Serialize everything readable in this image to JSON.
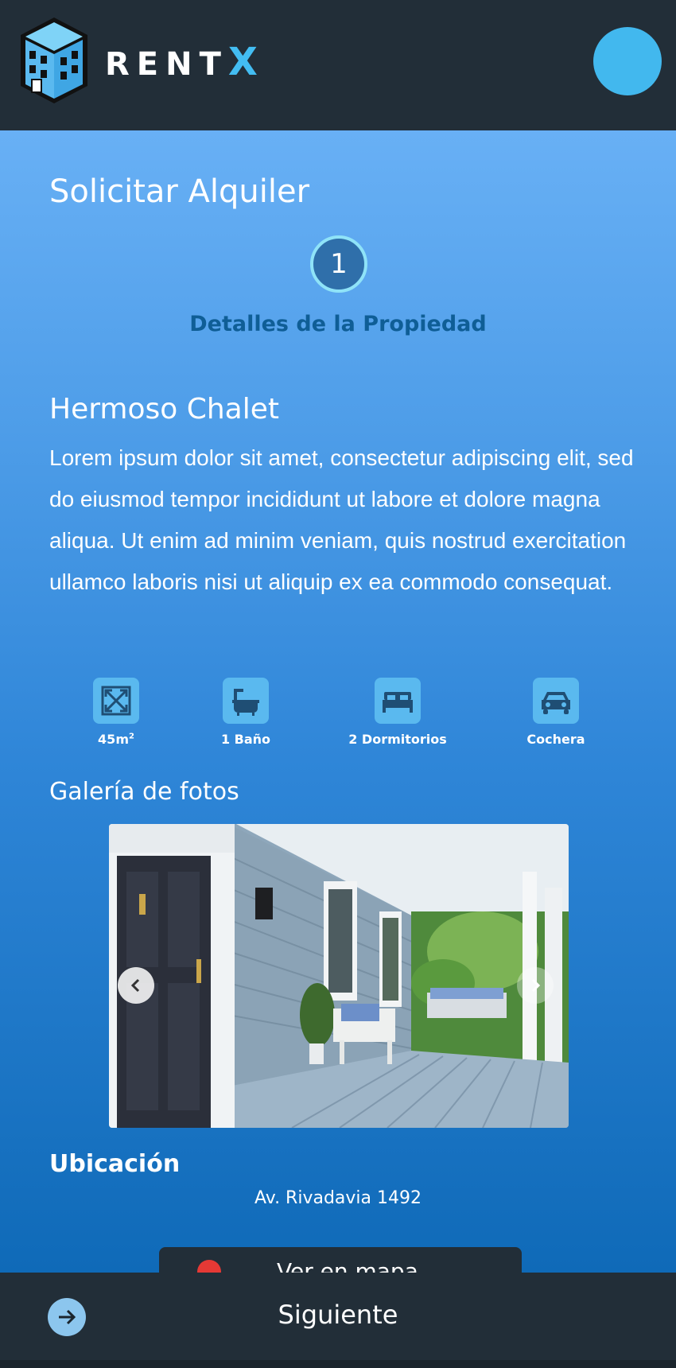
{
  "header": {
    "brand_main": "RENT",
    "brand_accent": "X",
    "logo_icon": "building-icon",
    "avatar": "user-avatar"
  },
  "page": {
    "title": "Solicitar Alquiler",
    "step_number": "1",
    "step_label": "Detalles de la Propiedad"
  },
  "property": {
    "title": "Hermoso Chalet",
    "description": "Lorem ipsum dolor sit amet, consectetur adipiscing elit, sed do eiusmod tempor incididunt ut labore et dolore magna aliqua. Ut enim ad minim veniam, quis nostrud exercitation ullamco laboris nisi ut aliquip ex ea commodo consequat."
  },
  "features": [
    {
      "icon": "expand-area-icon",
      "label": "45m",
      "sup": "2"
    },
    {
      "icon": "bathtub-icon",
      "label": "1 Baño"
    },
    {
      "icon": "bed-icon",
      "label": "2 Dormitorios"
    },
    {
      "icon": "car-icon",
      "label": "Cochera"
    }
  ],
  "gallery": {
    "title": "Galería de fotos",
    "prev_icon": "chevron-left-icon",
    "next_icon": "chevron-right-icon"
  },
  "location": {
    "title": "Ubicación",
    "address": "Av. Rivadavia 1492",
    "map_button": "Ver en mapa"
  },
  "footer": {
    "next_label": "Siguiente",
    "next_icon": "arrow-right-icon"
  },
  "colors": {
    "header_bg": "#222e38",
    "accent": "#43bdf2",
    "step_label": "#0f5e96"
  }
}
